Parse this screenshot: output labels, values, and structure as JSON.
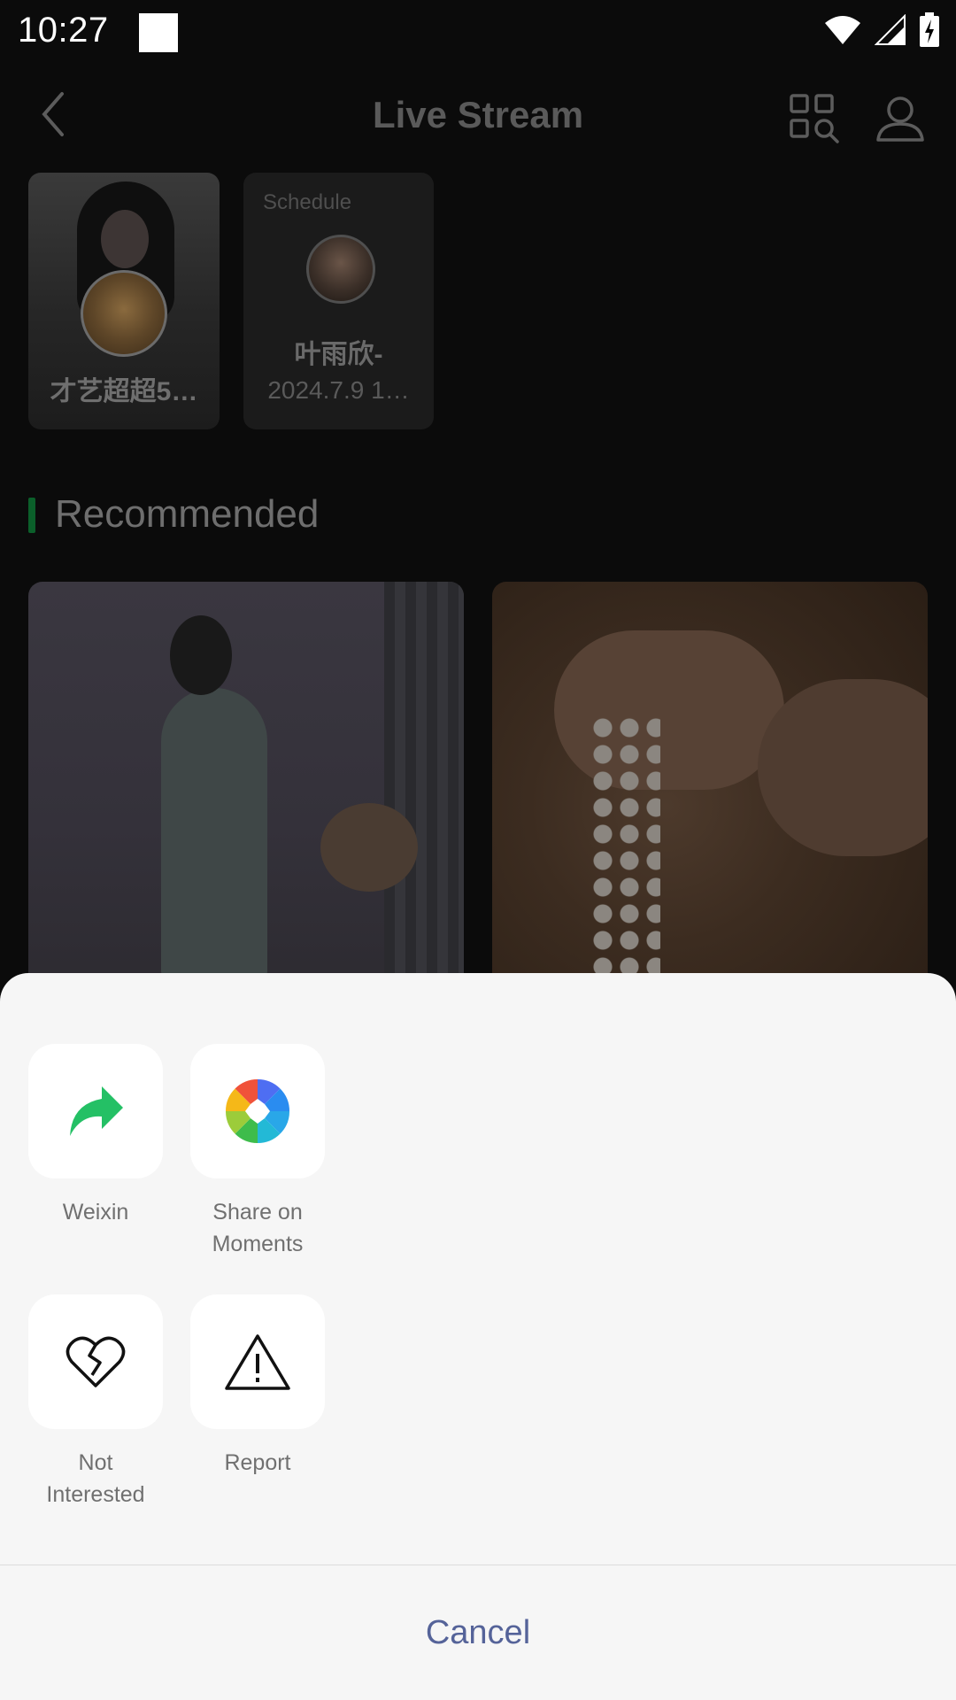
{
  "status_bar": {
    "time": "10:27"
  },
  "header": {
    "title": "Live Stream"
  },
  "live_cards": [
    {
      "name": "才艺超超5…"
    },
    {
      "tag": "Schedule",
      "name": "叶雨欣-",
      "time": "2024.7.9 1…"
    }
  ],
  "recommended": {
    "title": "Recommended"
  },
  "share_sheet": {
    "actions": [
      {
        "label": "Weixin",
        "icon": "share-arrow-icon",
        "color": "#24c065"
      },
      {
        "label": "Share on Moments",
        "icon": "moments-aperture-icon"
      },
      {
        "label": "Not Interested",
        "icon": "broken-heart-icon"
      },
      {
        "label": "Report",
        "icon": "warning-triangle-icon"
      }
    ],
    "cancel_label": "Cancel"
  },
  "colors": {
    "accent_green": "#0b5f2a",
    "cancel_text": "#556399",
    "sheet_bg": "#f6f6f6"
  }
}
